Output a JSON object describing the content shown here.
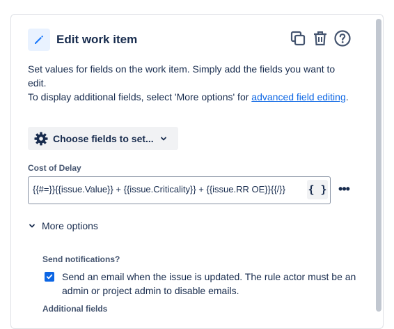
{
  "panel": {
    "title": "Edit work item",
    "description_line1": "Set values for fields on the work item. Simply add the fields you want to edit.",
    "description_line2_prefix": "To display additional fields, select 'More options' for ",
    "description_link": "advanced field editing",
    "description_line2_suffix": ".",
    "choose_fields_label": "Choose fields to set...",
    "field": {
      "label": "Cost of Delay",
      "value": "{{#=}}{{issue.Value}} + {{issue.Criticality}} + {{issue.RR OE}}{{/}}",
      "smart_values_label": "{ }",
      "more_label": "•••"
    },
    "more_options_label": "More options",
    "send_notifications": {
      "heading": "Send notifications?",
      "checked": true,
      "text": "Send an email when the issue is updated. The rule actor must be an admin or project admin to disable emails."
    },
    "additional_fields_heading": "Additional fields"
  },
  "icons": {
    "header": "pencil-icon",
    "duplicate": "copy-icon",
    "delete": "trash-icon",
    "help": "help-icon",
    "settings": "gear-icon",
    "chevron": "chevron-down-icon"
  },
  "colors": {
    "accent": "#0c66e4",
    "header_icon_bg": "#e9f2ff",
    "text": "#172b4d"
  }
}
